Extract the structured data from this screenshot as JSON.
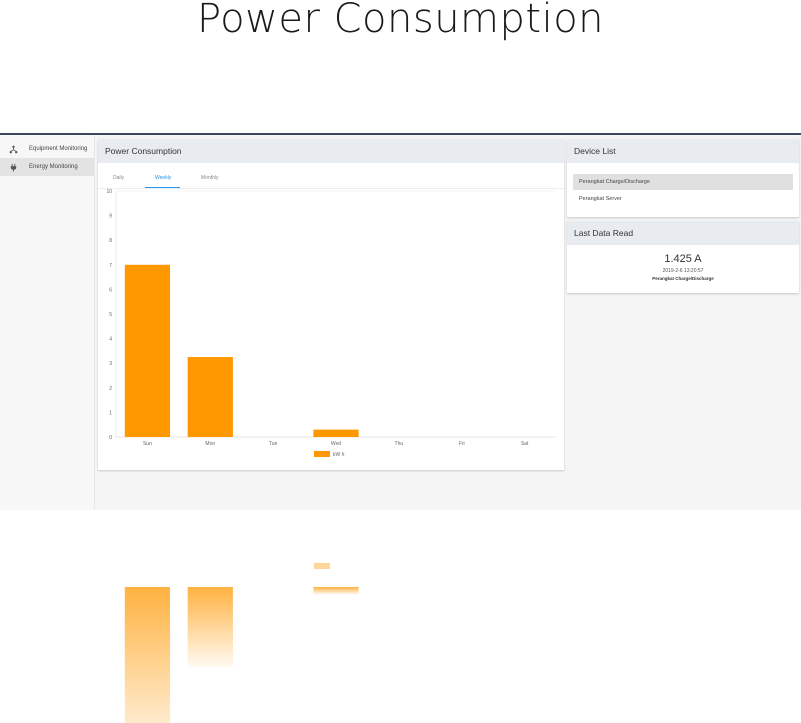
{
  "page_title": "Power Consumption",
  "sidebar": {
    "items": [
      {
        "label": "Equipment Monitoring",
        "icon": "network-icon"
      },
      {
        "label": "Energy Monitoring",
        "icon": "plug-icon"
      }
    ]
  },
  "power_consumption": {
    "header": "Power Consumption",
    "tabs": [
      "Daily",
      "Weekly",
      "Monthly"
    ],
    "active_tab": "Weekly"
  },
  "device_list": {
    "header": "Device List",
    "items": [
      "Perangkat Charge/Discharge",
      "Perangkat Server"
    ],
    "selected": "Perangkat Charge/Discharge"
  },
  "last_data_read": {
    "header": "Last Data Read",
    "value": "1.425 A",
    "timestamp": "2019-2-6 13:20:57",
    "device": "Perangkat Charge/Discharge"
  },
  "colors": {
    "bar": "#ff9800",
    "accent": "#2196f3",
    "header_bg": "#e8ecf1"
  },
  "chart_data": {
    "type": "bar",
    "categories": [
      "Sun",
      "Mon",
      "Tue",
      "Wed",
      "Thu",
      "Fri",
      "Sat"
    ],
    "series": [
      {
        "name": "kW h",
        "values": [
          7,
          3.25,
          0,
          0.3,
          0,
          0,
          0
        ]
      }
    ],
    "ylim": [
      0,
      10
    ],
    "yticks": [
      0,
      1,
      2,
      3,
      4,
      5,
      6,
      7,
      8,
      9,
      10
    ],
    "legend": "bottom-center",
    "grid": false
  }
}
